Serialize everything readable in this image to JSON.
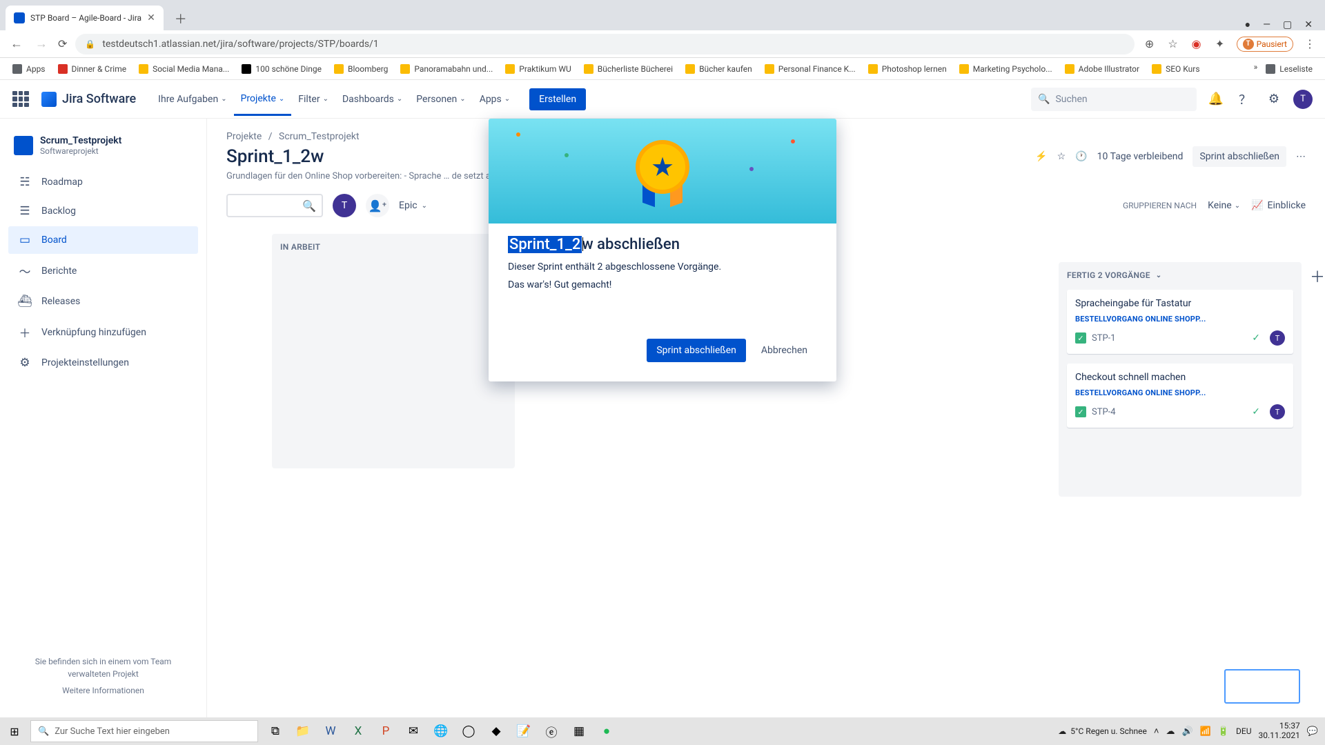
{
  "browser": {
    "tab_title": "STP Board – Agile-Board - Jira",
    "url": "testdeutsch1.atlassian.net/jira/software/projects/STP/boards/1",
    "pause_label": "Pausiert",
    "bookmarks": [
      {
        "label": "Apps",
        "color": "#5f6368"
      },
      {
        "label": "Dinner & Crime",
        "color": "#d93025"
      },
      {
        "label": "Social Media Mana...",
        "color": "#fbbc04"
      },
      {
        "label": "100 schöne Dinge",
        "color": "#000"
      },
      {
        "label": "Bloomberg",
        "color": "#fbbc04"
      },
      {
        "label": "Panoramabahn und...",
        "color": "#fbbc04"
      },
      {
        "label": "Praktikum WU",
        "color": "#fbbc04"
      },
      {
        "label": "Bücherliste Bücherei",
        "color": "#fbbc04"
      },
      {
        "label": "Bücher kaufen",
        "color": "#fbbc04"
      },
      {
        "label": "Personal Finance K...",
        "color": "#fbbc04"
      },
      {
        "label": "Photoshop lernen",
        "color": "#fbbc04"
      },
      {
        "label": "Marketing Psycholo...",
        "color": "#fbbc04"
      },
      {
        "label": "Adobe Illustrator",
        "color": "#fbbc04"
      },
      {
        "label": "SEO Kurs",
        "color": "#fbbc04"
      }
    ],
    "leseliste": "Leseliste"
  },
  "nav": {
    "product": "Jira Software",
    "items": [
      "Ihre Aufgaben",
      "Projekte",
      "Filter",
      "Dashboards",
      "Personen",
      "Apps"
    ],
    "active_index": 1,
    "create": "Erstellen",
    "search_placeholder": "Suchen",
    "avatar": "T"
  },
  "sidebar": {
    "project": {
      "name": "Scrum_Testprojekt",
      "type": "Softwareprojekt"
    },
    "items": [
      {
        "icon": "☵",
        "label": "Roadmap"
      },
      {
        "icon": "☰",
        "label": "Backlog"
      },
      {
        "icon": "▭",
        "label": "Board",
        "active": true
      },
      {
        "icon": "〜",
        "label": "Berichte"
      },
      {
        "icon": "⛴",
        "label": "Releases"
      },
      {
        "icon": "＋",
        "label": "Verknüpfung hinzufügen"
      },
      {
        "icon": "⚙",
        "label": "Projekteinstellungen"
      }
    ],
    "footer": "Sie befinden sich in einem vom Team verwalteten Projekt",
    "footer_link": "Weitere Informationen"
  },
  "page": {
    "breadcrumb": {
      "root": "Projekte",
      "sep": "/",
      "proj": "Scrum_Testprojekt"
    },
    "title": "Sprint_1_2w",
    "description": "Grundlagen für den Online Shop vorbereiten: - Sprache … de setzt auf Bestellgeschwindigkeit)",
    "days_remaining": "10 Tage verbleibend",
    "complete_sprint": "Sprint abschließen",
    "epic": "Epic",
    "group_label": "GRUPPIEREN NACH",
    "group_value": "Keine",
    "insights": "Einblicke"
  },
  "columns": {
    "in_progress": "IN ARBEIT",
    "done": "FERTIG 2 VORGÄNGE"
  },
  "cards": [
    {
      "title": "Spracheingabe für Tastatur",
      "tag": "BESTELLVORGANG ONLINE SHOPP...",
      "key": "STP-1",
      "assignee": "T"
    },
    {
      "title": "Checkout schnell machen",
      "tag": "BESTELLVORGANG ONLINE SHOPP...",
      "key": "STP-4",
      "assignee": "T"
    }
  ],
  "modal": {
    "title_highlighted": "Sprint_1_2",
    "title_rest": "w abschließen",
    "line1": "Dieser Sprint enthält  2 abgeschlossene Vorgänge.",
    "line2": "Das war's! Gut gemacht!",
    "primary": "Sprint abschließen",
    "cancel": "Abbrechen"
  },
  "taskbar": {
    "search_placeholder": "Zur Suche Text hier eingeben",
    "weather": "5°C  Regen u. Schnee",
    "lang": "DEU",
    "time": "15:37",
    "date": "30.11.2021"
  }
}
